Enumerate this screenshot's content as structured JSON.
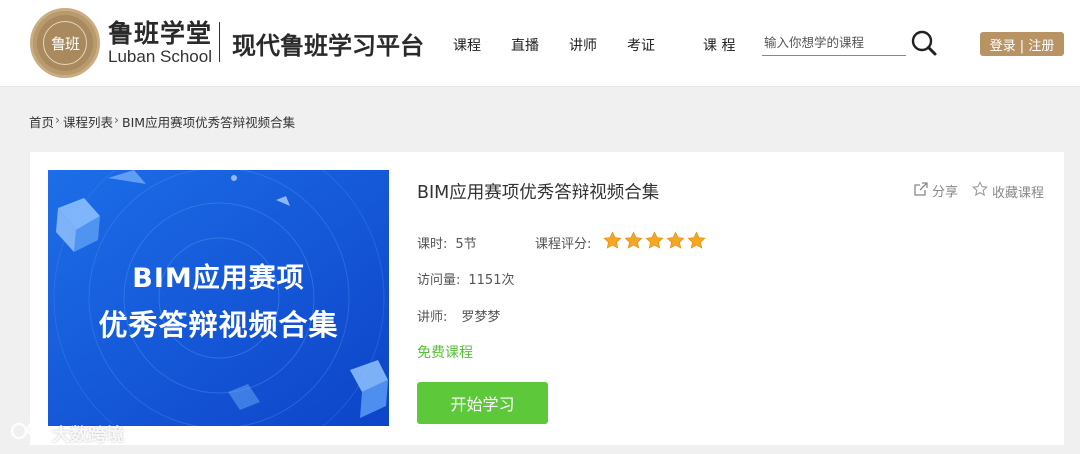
{
  "header": {
    "logo": {
      "name": "luban-seal-logo",
      "seal_text": "鲁班"
    },
    "brand_cn": "鲁班学堂",
    "brand_en": "Luban School",
    "platform_title": "现代鲁班学习平台",
    "nav": [
      "课程",
      "直播",
      "讲师",
      "考证"
    ],
    "search_category": "课 程",
    "search_placeholder": "输入你想学的课程",
    "login_label": "登录 | 注册"
  },
  "breadcrumb": [
    "首页",
    "课程列表",
    "BIM应用赛项优秀答辩视频合集"
  ],
  "course": {
    "cover_line1": "BIM应用赛项",
    "cover_line2": "优秀答辩视频合集",
    "title": "BIM应用赛项优秀答辩视频合集",
    "share_label": "分享",
    "favorite_label": "收藏课程",
    "lessons_label": "课时:",
    "lessons_value": "5节",
    "rating_label": "课程评分:",
    "rating_stars": 5,
    "rating_max": 5,
    "visits_label": "访问量:",
    "visits_value": "1151次",
    "teacher_label": "讲师:",
    "teacher_value": "罗梦梦",
    "price_label": "免费课程",
    "start_label": "开始学习"
  },
  "watermark": "大数跨境",
  "colors": {
    "gold": "#b89465",
    "green": "#5cc83a",
    "star": "#f5a623",
    "cover_blue": "#1559dc"
  }
}
